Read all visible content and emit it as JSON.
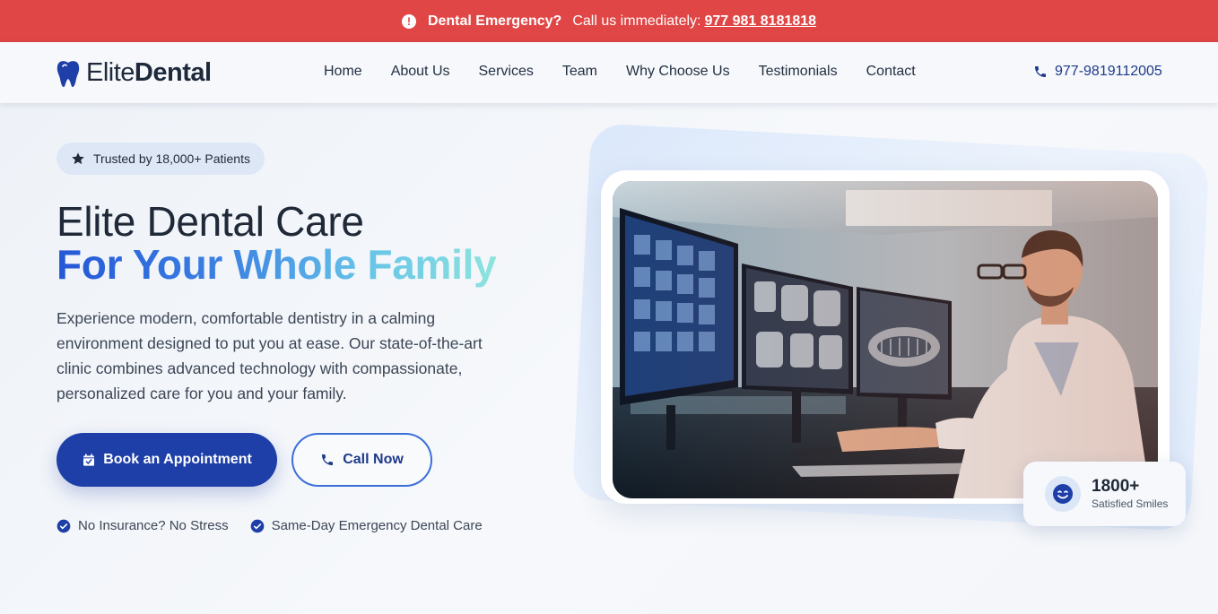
{
  "emergency": {
    "title": "Dental Emergency?",
    "text": "Call us immediately:",
    "phone": "977 981 8181818",
    "bg_color": "#e04646"
  },
  "header": {
    "logo_part1": "Elite",
    "logo_part2": "Dental",
    "logo_icon": "tooth-icon",
    "nav": [
      "Home",
      "About Us",
      "Services",
      "Team",
      "Why Choose Us",
      "Testimonials",
      "Contact"
    ],
    "phone": "977-9819112005",
    "phone_icon": "phone-icon"
  },
  "hero": {
    "badge": "Trusted by 18,000+ Patients",
    "badge_icon": "star-icon",
    "title_line1": "Elite Dental Care",
    "title_line2": "For Your Whole Family",
    "description": "Experience modern, comfortable dentistry in a calming environment designed to put you at ease. Our state-of-the-art clinic combines advanced technology with compassionate, personalized care for you and your family.",
    "book_button": "Book an Appointment",
    "book_icon": "calendar-check-icon",
    "call_button": "Call Now",
    "call_icon": "phone-icon",
    "features": [
      "No Insurance? No Stress",
      "Same-Day Emergency Dental Care"
    ],
    "feature_icon": "check-circle-icon"
  },
  "stats": {
    "number": "1800+",
    "label": "Satisfied Smiles",
    "icon": "smile-icon"
  },
  "colors": {
    "primary": "#1e3fa8",
    "accent_gradient": [
      "#2457d6",
      "#8ee4dd"
    ],
    "dark_text": "#1f2937"
  }
}
